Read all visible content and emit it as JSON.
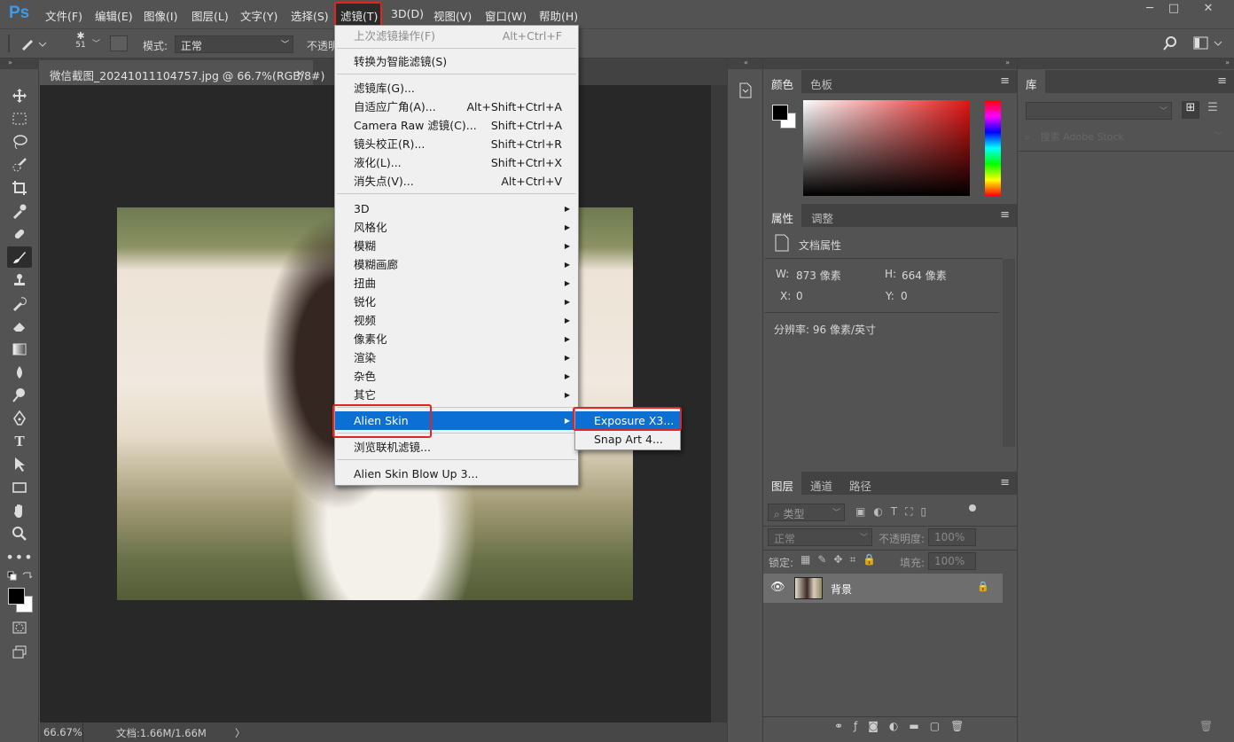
{
  "app": {
    "logo": "Ps"
  },
  "menubar": [
    "文件(F)",
    "编辑(E)",
    "图像(I)",
    "图层(L)",
    "文字(Y)",
    "选择(S)",
    "滤镜(T)",
    "3D(D)",
    "视图(V)",
    "窗口(W)",
    "帮助(H)"
  ],
  "options": {
    "brush_size": "51",
    "mode_label": "模式:",
    "mode_value": "正常",
    "opacity_label": "不透明"
  },
  "document": {
    "tab_title": "微信截图_20241011104757.jpg @ 66.7%(RGB/8#)",
    "close": "×",
    "zoom": "66.67%",
    "doc_info": "文档:1.66M/1.66M",
    "arrow": "〉"
  },
  "filter_menu": {
    "last_filter": "上次滤镜操作(F)",
    "last_filter_sc": "Alt+Ctrl+F",
    "smart": "转换为智能滤镜(S)",
    "gallery": "滤镜库(G)...",
    "adaptive": "自适应广角(A)...",
    "adaptive_sc": "Alt+Shift+Ctrl+A",
    "camera_raw": "Camera Raw 滤镜(C)...",
    "camera_raw_sc": "Shift+Ctrl+A",
    "lens": "镜头校正(R)...",
    "lens_sc": "Shift+Ctrl+R",
    "liquify": "液化(L)...",
    "liquify_sc": "Shift+Ctrl+X",
    "vanish": "消失点(V)...",
    "vanish_sc": "Alt+Ctrl+V",
    "subs": [
      "3D",
      "风格化",
      "模糊",
      "模糊画廊",
      "扭曲",
      "锐化",
      "视频",
      "像素化",
      "渲染",
      "杂色",
      "其它"
    ],
    "alien_skin": "Alien Skin",
    "browse": "浏览联机滤镜...",
    "blowup": "Alien Skin Blow Up 3..."
  },
  "submenu": {
    "exposure": "Exposure X3...",
    "snap_art": "Snap Art 4..."
  },
  "color_panel": {
    "tabs": [
      "颜色",
      "色板"
    ]
  },
  "properties": {
    "tabs": [
      "属性",
      "调整"
    ],
    "doc_props": "文档属性",
    "w_label": "W:",
    "w_value": "873 像素",
    "h_label": "H:",
    "h_value": "664 像素",
    "x_label": "X:",
    "x_value": "0",
    "y_label": "Y:",
    "y_value": "0",
    "resolution": "分辨率: 96 像素/英寸"
  },
  "layers": {
    "tabs": [
      "图层",
      "通道",
      "路径"
    ],
    "filter_kind": "类型",
    "blend": "正常",
    "opacity_label": "不透明度:",
    "opacity_value": "100%",
    "lock_label": "锁定:",
    "fill_label": "填充:",
    "fill_value": "100%",
    "layer_name": "背景"
  },
  "library": {
    "tab": "库",
    "search_placeholder": "搜索 Adobe Stock"
  }
}
